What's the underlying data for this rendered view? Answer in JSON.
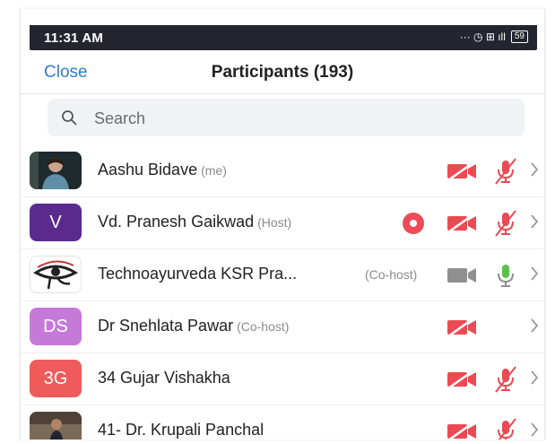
{
  "status": {
    "time": "11:31 AM",
    "icons_text": "··· ◷ ⊞ ıll",
    "battery": "59"
  },
  "header": {
    "close_label": "Close",
    "title": "Participants (193)"
  },
  "search": {
    "placeholder": "Search"
  },
  "colors": {
    "accent": "#2f7bd3",
    "muted": "#ea4a52",
    "unmuted": "#5cbf4a",
    "video_on": "#8f8f8f"
  },
  "participants": [
    {
      "name": "Aashu Bidave",
      "role": "(me)",
      "avatar": "photo",
      "video": "off",
      "audio": "muted"
    },
    {
      "name": "Vd. Pranesh Gaikwad",
      "role": "(Host)",
      "avatar_initials": "V",
      "avatar_color": "#5a2a8e",
      "recording": true,
      "video": "off",
      "audio": "muted"
    },
    {
      "name": "Technoayurveda KSR Pra...",
      "role": "(Co-host)",
      "avatar": "eye-logo",
      "video": "on",
      "audio": "unmuted"
    },
    {
      "name": "Dr Snehlata Pawar",
      "role": "(Co-host)",
      "avatar_initials": "DS",
      "avatar_color": "#c57ad8",
      "video": "off",
      "audio": "none"
    },
    {
      "name": "34 Gujar Vishakha",
      "role": "",
      "avatar_initials": "3G",
      "avatar_color": "#ef5a5a",
      "video": "off",
      "audio": "muted"
    },
    {
      "name": "41- Dr. Krupali Panchal",
      "role": "",
      "avatar": "photo",
      "video": "off",
      "audio": "muted"
    }
  ]
}
